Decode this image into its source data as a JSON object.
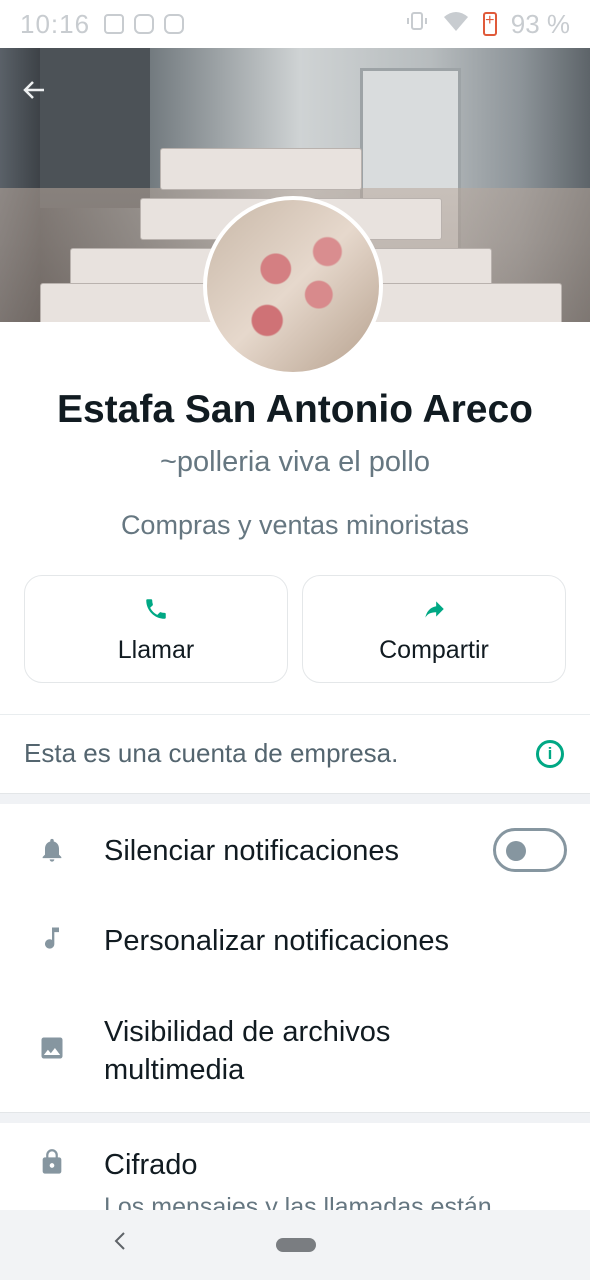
{
  "status_bar": {
    "time": "10:16",
    "battery": "93 %"
  },
  "profile": {
    "name": "Estafa San Antonio Areco",
    "subtitle": "~polleria viva el pollo",
    "category": "Compras y ventas minoristas"
  },
  "actions": [
    {
      "label": "Llamar",
      "icon": "phone-icon"
    },
    {
      "label": "Compartir",
      "icon": "share-icon"
    }
  ],
  "business_notice": {
    "text": "Esta es una cuenta de empresa.",
    "icon": "info-icon"
  },
  "settings": {
    "mute": {
      "label": "Silenciar notificaciones",
      "icon": "bell-icon",
      "toggle_on": false
    },
    "custom_notifications": {
      "label": "Personalizar notificaciones",
      "icon": "music-note-icon"
    },
    "media_visibility": {
      "label_line1": "Visibilidad de archivos",
      "label_line2": "multimedia",
      "icon": "image-icon"
    },
    "encryption": {
      "label": "Cifrado",
      "description": "Los mensajes y las llamadas están",
      "icon": "lock-icon"
    }
  },
  "colors": {
    "accent": "#00a884",
    "secondary_text": "#667781",
    "icon_gray": "#8696a0"
  }
}
